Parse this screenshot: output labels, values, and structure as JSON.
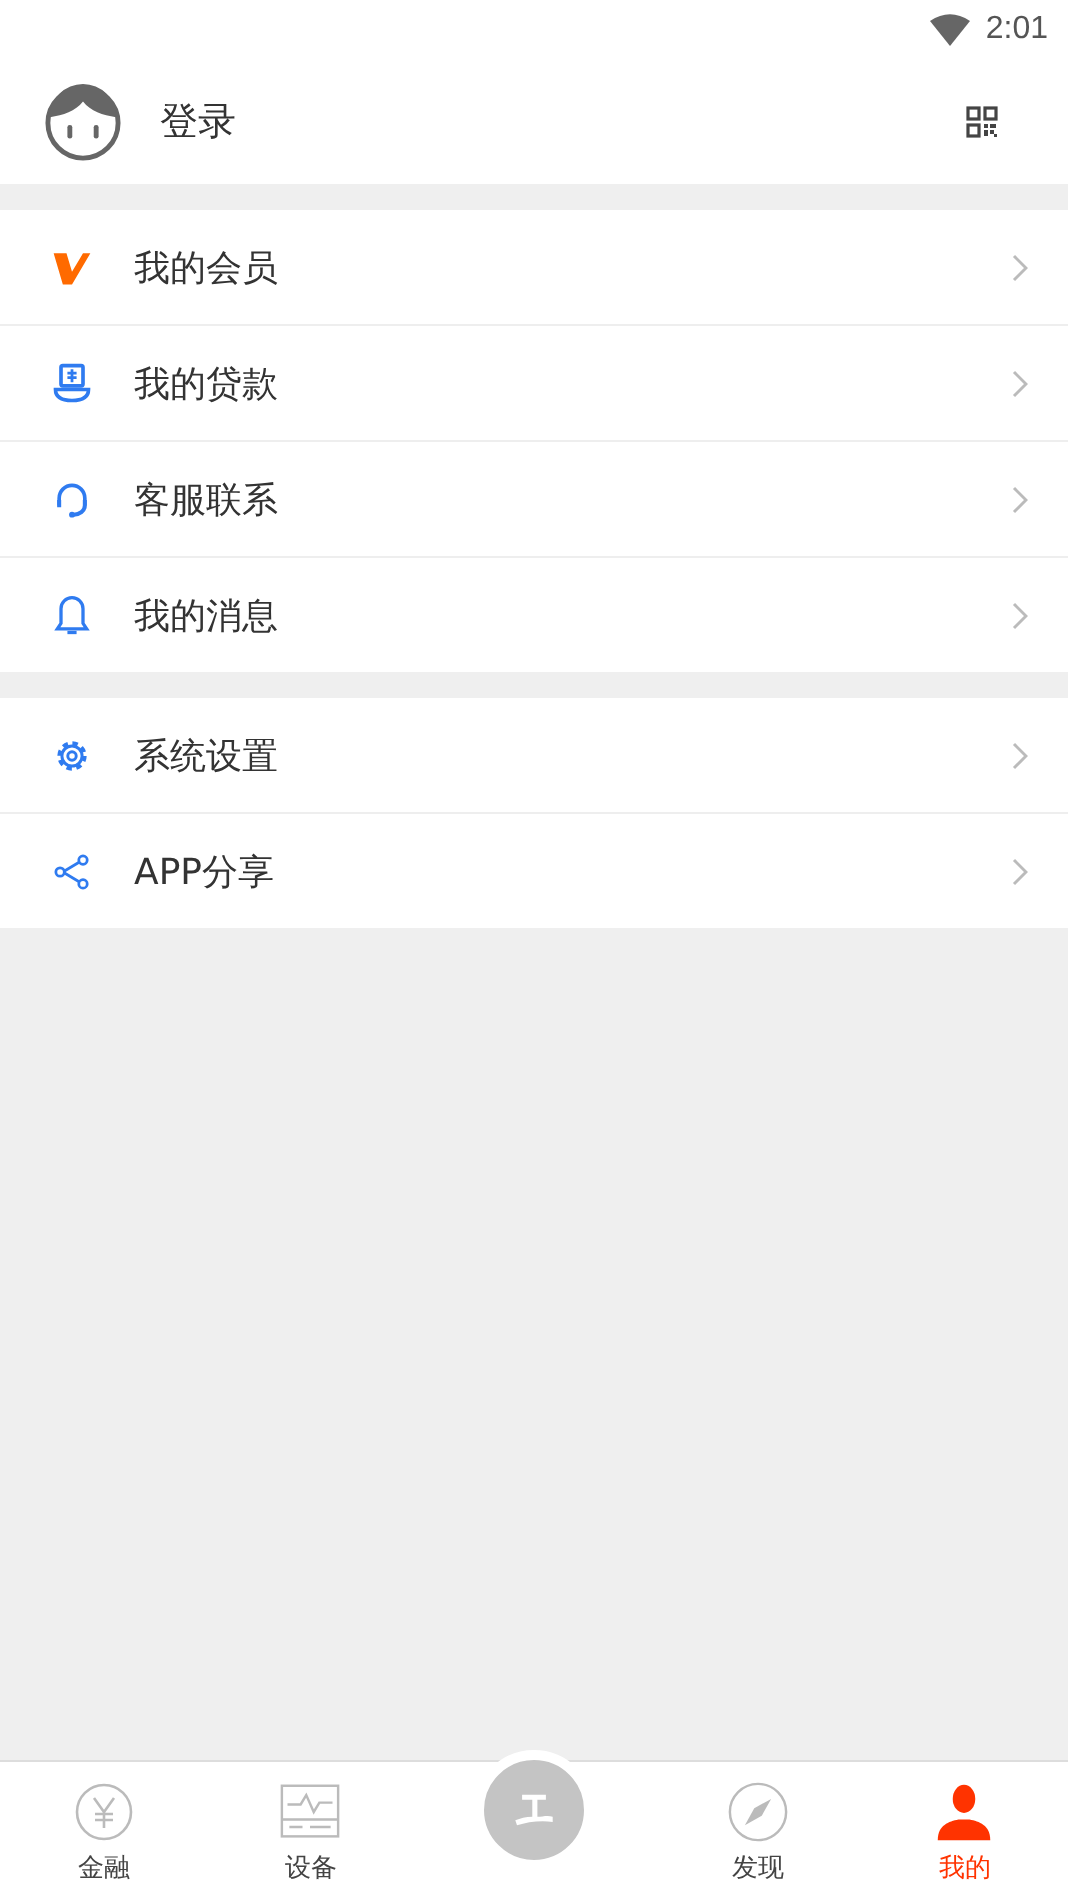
{
  "status_bar": {
    "time": "2:01"
  },
  "header": {
    "login_label": "登录"
  },
  "menu_groups": [
    {
      "items": [
        {
          "label": "我的会员"
        },
        {
          "label": "我的贷款"
        },
        {
          "label": "客服联系"
        },
        {
          "label": "我的消息"
        }
      ]
    },
    {
      "items": [
        {
          "label": "系统设置"
        },
        {
          "label": "APP分享"
        }
      ]
    }
  ],
  "tab_bar": [
    {
      "label": "金融",
      "selected": false
    },
    {
      "label": "设备",
      "selected": false
    },
    {
      "selected": false
    },
    {
      "label": "发现",
      "selected": false
    },
    {
      "label": "我的",
      "selected": true
    }
  ]
}
